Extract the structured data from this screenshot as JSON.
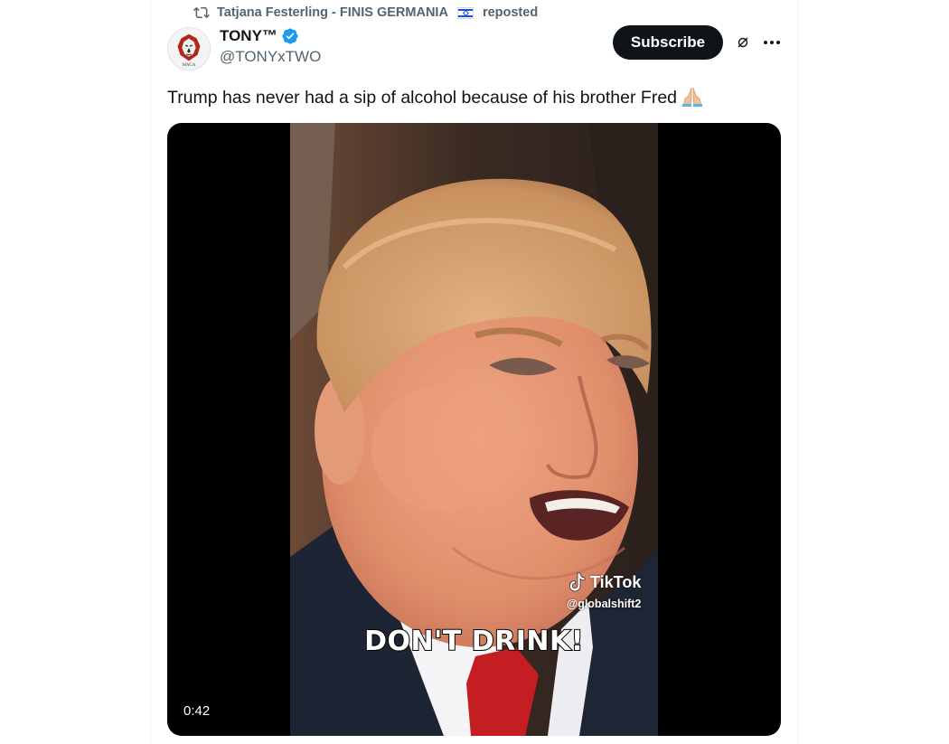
{
  "repost": {
    "icon": "repost-icon",
    "user": "Tatjana Festerling - FINIS GERMANIA",
    "flag": "israel-flag",
    "suffix": "reposted"
  },
  "author": {
    "display_name": "TONY™",
    "verified": true,
    "handle": "@TONYxTWO",
    "avatar": "lion-maga-logo",
    "avatar_text": "MAGA"
  },
  "actions": {
    "subscribe_label": "Subscribe",
    "grok_icon": "grok-icon",
    "more_icon": "more-icon"
  },
  "tweet": {
    "text": "Trump has never had a sip of alcohol because of his brother Fred",
    "emoji": "folded-hands-emoji"
  },
  "media": {
    "type": "video",
    "caption": "DON'T DRINK!",
    "watermark_brand": "TikTok",
    "watermark_handle": "@globalshift2",
    "duration": "0:42"
  },
  "colors": {
    "text_primary": "#0f1419",
    "text_secondary": "#536471",
    "verified_blue": "#1d9bf0",
    "button_dark": "#0f1419"
  }
}
